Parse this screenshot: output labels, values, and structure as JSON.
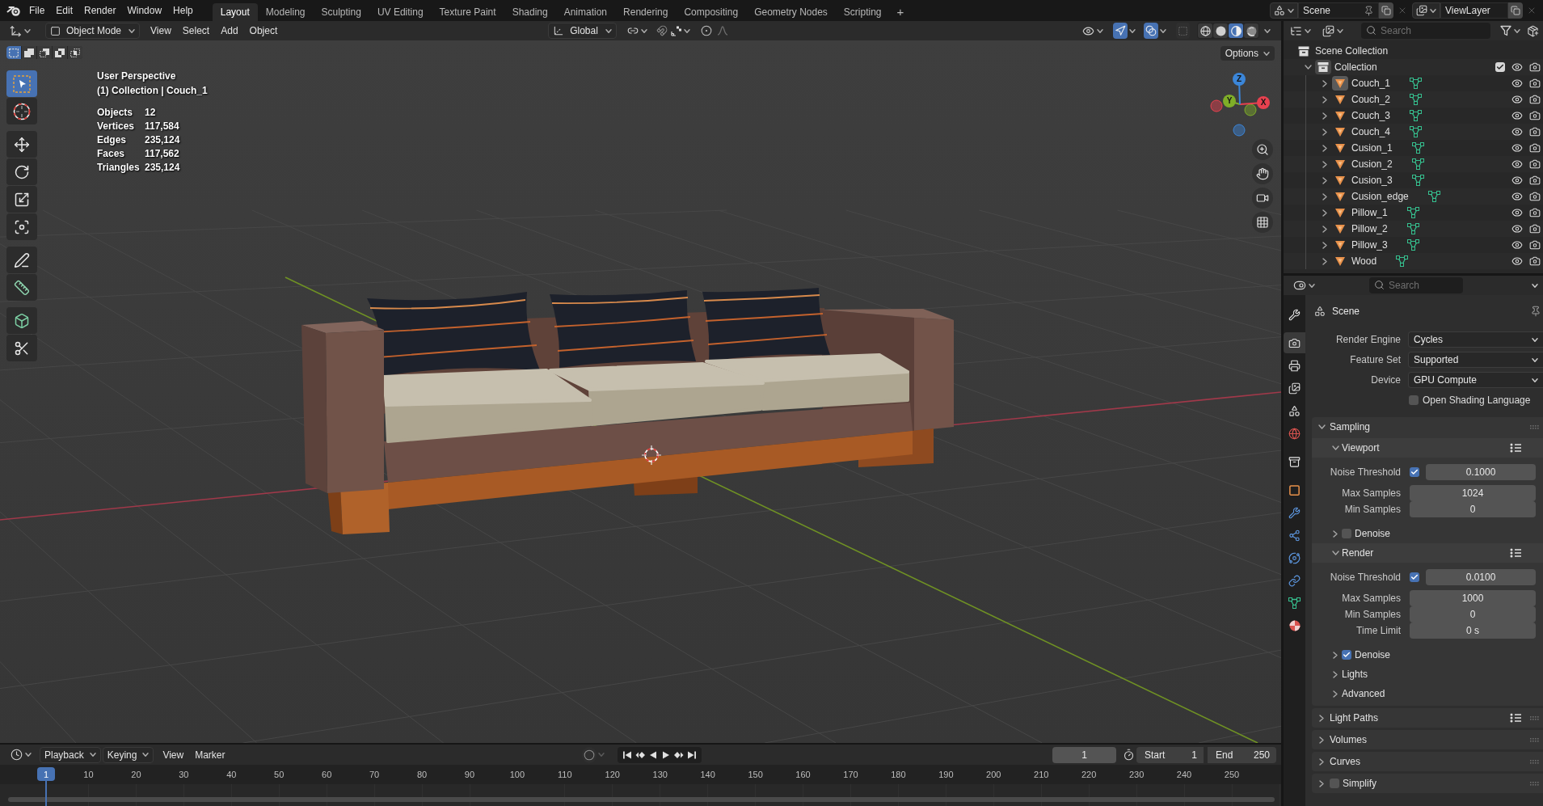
{
  "top_bar": {
    "menus": [
      "File",
      "Edit",
      "Render",
      "Window",
      "Help"
    ],
    "workspaces": [
      {
        "label": "Layout",
        "selected": true
      },
      {
        "label": "Modeling",
        "selected": false
      },
      {
        "label": "Sculpting",
        "selected": false
      },
      {
        "label": "UV Editing",
        "selected": false
      },
      {
        "label": "Texture Paint",
        "selected": false
      },
      {
        "label": "Shading",
        "selected": false
      },
      {
        "label": "Animation",
        "selected": false
      },
      {
        "label": "Rendering",
        "selected": false
      },
      {
        "label": "Compositing",
        "selected": false
      },
      {
        "label": "Geometry Nodes",
        "selected": false
      },
      {
        "label": "Scripting",
        "selected": false
      }
    ],
    "add_workspace": "+",
    "scene": "Scene",
    "view_layer": "ViewLayer"
  },
  "viewport_header": {
    "mode": "Object Mode",
    "menus": [
      "View",
      "Select",
      "Add",
      "Object"
    ],
    "orientation": "Global",
    "gizmos_on": true,
    "overlays_on": true,
    "xray_on": false,
    "shading": [
      {
        "kind": "wireframe",
        "selected": false
      },
      {
        "kind": "solid",
        "selected": false
      },
      {
        "kind": "material",
        "selected": true
      },
      {
        "kind": "rendered",
        "selected": false
      }
    ]
  },
  "viewport": {
    "select_modes": [
      {
        "kind": "new",
        "selected": true
      },
      {
        "kind": "extend",
        "selected": false
      },
      {
        "kind": "subtract",
        "selected": false
      },
      {
        "kind": "invert",
        "selected": false
      },
      {
        "kind": "intersect",
        "selected": false
      }
    ],
    "tool_groups": [
      [
        {
          "kind": "select_box",
          "selected": true
        },
        {
          "kind": "cursor",
          "selected": false
        }
      ],
      [
        {
          "kind": "move",
          "selected": false
        },
        {
          "kind": "rotate",
          "selected": false
        },
        {
          "kind": "scale",
          "selected": false
        },
        {
          "kind": "transform",
          "selected": false
        }
      ],
      [
        {
          "kind": "annotate",
          "selected": false
        },
        {
          "kind": "measure",
          "selected": false
        }
      ],
      [
        {
          "kind": "add_cube",
          "selected": false
        },
        {
          "kind": "shear",
          "selected": false
        }
      ]
    ],
    "view_name": "User Perspective",
    "context": "(1) Collection | Couch_1",
    "stats": [
      {
        "label": "Objects",
        "value": "12"
      },
      {
        "label": "Vertices",
        "value": "117,584"
      },
      {
        "label": "Edges",
        "value": "235,124"
      },
      {
        "label": "Faces",
        "value": "117,562"
      },
      {
        "label": "Triangles",
        "value": "235,124"
      }
    ],
    "options": "Options",
    "gizmo_axes": [
      {
        "label": "X",
        "color": "#e8414f"
      },
      {
        "label": "Y",
        "color": "#7fae28"
      },
      {
        "label": "Z",
        "color": "#3b86d9"
      }
    ]
  },
  "timeline": {
    "menus": [
      {
        "label": "Playback",
        "dropdown": true
      },
      {
        "label": "Keying",
        "dropdown": true
      },
      {
        "label": "View",
        "dropdown": false
      },
      {
        "label": "Marker",
        "dropdown": false
      }
    ],
    "current_frame": "1",
    "start_label": "Start",
    "start": "1",
    "end_label": "End",
    "end": "250",
    "playhead": "1",
    "ruler": [
      "10",
      "20",
      "30",
      "40",
      "50",
      "60",
      "70",
      "80",
      "90",
      "100",
      "110",
      "120",
      "130",
      "140",
      "150",
      "160",
      "170",
      "180",
      "190",
      "200",
      "210",
      "220",
      "230",
      "240",
      "250"
    ]
  },
  "outliner": {
    "search_placeholder": "Search",
    "tree": [
      {
        "kind": "scene_collection",
        "label": "Scene Collection",
        "children": [
          {
            "kind": "collection",
            "label": "Collection",
            "expanded": true,
            "checked": true,
            "children": [
              {
                "kind": "object",
                "label": "Couch_1",
                "expanded": false,
                "selected": true
              },
              {
                "kind": "object",
                "label": "Couch_2",
                "expanded": false,
                "selected": false
              },
              {
                "kind": "object",
                "label": "Couch_3",
                "expanded": false,
                "selected": false
              },
              {
                "kind": "object",
                "label": "Couch_4",
                "expanded": false,
                "selected": false
              },
              {
                "kind": "object",
                "label": "Cusion_1",
                "expanded": false,
                "selected": false
              },
              {
                "kind": "object",
                "label": "Cusion_2",
                "expanded": false,
                "selected": false
              },
              {
                "kind": "object",
                "label": "Cusion_3",
                "expanded": false,
                "selected": false
              },
              {
                "kind": "object",
                "label": "Cusion_edge",
                "expanded": false,
                "selected": false
              },
              {
                "kind": "object",
                "label": "Pillow_1",
                "expanded": false,
                "selected": false
              },
              {
                "kind": "object",
                "label": "Pillow_2",
                "expanded": false,
                "selected": false
              },
              {
                "kind": "object",
                "label": "Pillow_3",
                "expanded": false,
                "selected": false
              },
              {
                "kind": "object",
                "label": "Wood",
                "expanded": false,
                "selected": false
              }
            ]
          }
        ]
      }
    ]
  },
  "properties": {
    "search_placeholder": "Search",
    "tab_groups": [
      [
        {
          "kind": "tool",
          "selected": false
        }
      ],
      [
        {
          "kind": "render",
          "selected": true
        },
        {
          "kind": "output",
          "selected": false
        },
        {
          "kind": "view_layer",
          "selected": false
        },
        {
          "kind": "scene",
          "selected": false
        },
        {
          "kind": "world",
          "selected": false
        }
      ],
      [
        {
          "kind": "collection",
          "selected": false
        }
      ],
      [
        {
          "kind": "object",
          "selected": false
        },
        {
          "kind": "modifiers",
          "selected": false
        },
        {
          "kind": "particles",
          "selected": false
        },
        {
          "kind": "physics",
          "selected": false
        },
        {
          "kind": "constraints",
          "selected": false
        },
        {
          "kind": "data",
          "selected": false
        },
        {
          "kind": "material",
          "selected": false
        }
      ]
    ],
    "context": "Scene",
    "fields": [
      {
        "kind": "dropdown",
        "label": "Render Engine",
        "value": "Cycles"
      },
      {
        "kind": "dropdown",
        "label": "Feature Set",
        "value": "Supported"
      },
      {
        "kind": "dropdown",
        "label": "Device",
        "value": "GPU Compute"
      },
      {
        "kind": "checkbox",
        "label": "Open Shading Language",
        "checked": false
      }
    ],
    "panels": [
      {
        "title": "Sampling",
        "expanded": true,
        "children": [
          {
            "title": "Viewport",
            "expanded": true,
            "presets": true,
            "rows": [
              {
                "kind": "toggle_number",
                "label": "Noise Threshold",
                "checked": true,
                "value": "0.1000"
              },
              {
                "kind": "number",
                "label": "Max Samples",
                "value": "1024"
              },
              {
                "kind": "number",
                "label": "Min Samples",
                "value": "0"
              }
            ],
            "children": [
              {
                "title": "Denoise",
                "expanded": false,
                "checked": false
              }
            ]
          },
          {
            "title": "Render",
            "expanded": true,
            "presets": true,
            "rows": [
              {
                "kind": "toggle_number",
                "label": "Noise Threshold",
                "checked": true,
                "value": "0.0100"
              },
              {
                "kind": "number",
                "label": "Max Samples",
                "value": "1000"
              },
              {
                "kind": "number",
                "label": "Min Samples",
                "value": "0"
              },
              {
                "kind": "number",
                "label": "Time Limit",
                "value": "0 s"
              }
            ],
            "children": [
              {
                "title": "Denoise",
                "expanded": false,
                "checked": true
              }
            ]
          },
          {
            "title": "Lights",
            "expanded": false
          },
          {
            "title": "Advanced",
            "expanded": false
          }
        ]
      },
      {
        "title": "Light Paths",
        "expanded": false,
        "presets": true
      },
      {
        "title": "Volumes",
        "expanded": false
      },
      {
        "title": "Curves",
        "expanded": false
      },
      {
        "title": "Simplify",
        "expanded": false,
        "checked": false
      }
    ]
  }
}
